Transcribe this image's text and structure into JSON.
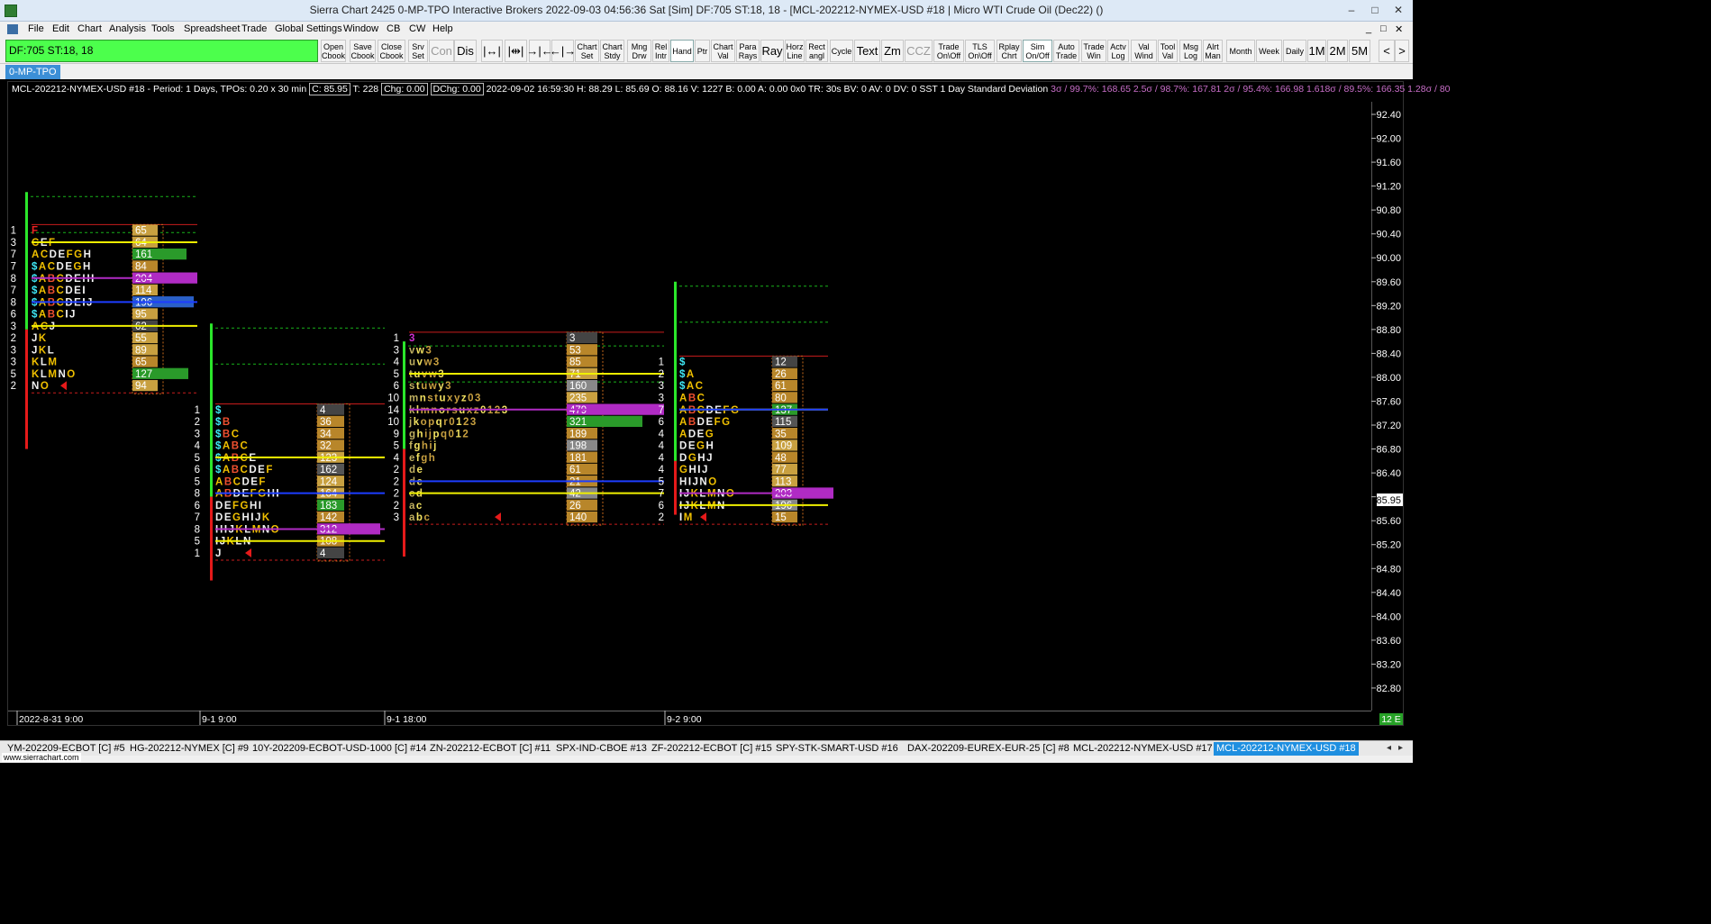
{
  "window": {
    "title": "Sierra Chart 2425 0-MP-TPO  Interactive Brokers 2022-09-03  04:56:36 Sat [Sim]  DF:705  ST:18, 18 - [MCL-202212-NYMEX-USD  #18 | Micro WTI Crude Oil (Dec22) ()",
    "buttons": [
      "–",
      "□",
      "✕"
    ]
  },
  "menu": {
    "items": [
      "File",
      "Edit",
      "Chart",
      "Analysis",
      "Tools",
      "Spreadsheet",
      "Trade",
      "Global Settings",
      "Window",
      "CB",
      "CW",
      "Help"
    ],
    "mdi_buttons": [
      "_",
      "□",
      "✕"
    ]
  },
  "toolbar": {
    "status_text": "DF:705  ST:18, 18",
    "buttons": [
      {
        "label": "Open\nCbook",
        "style": ""
      },
      {
        "label": "Save\nCbook",
        "style": ""
      },
      {
        "label": "Close\nCbook",
        "style": ""
      },
      {
        "label": "Srv\nSet",
        "style": ""
      },
      {
        "label": "Con",
        "style": "big dim"
      },
      {
        "label": "Dis",
        "style": "big"
      },
      {
        "label": "|↔|",
        "style": "big"
      },
      {
        "label": "|⇹|",
        "style": "big"
      },
      {
        "label": "→|←",
        "style": "big"
      },
      {
        "label": "←|→",
        "style": "big"
      },
      {
        "label": "Chart\nSet",
        "style": ""
      },
      {
        "label": "Chart\nStdy",
        "style": ""
      },
      {
        "label": "Mng\nDrw",
        "style": ""
      },
      {
        "label": "Rel\nIntr",
        "style": ""
      },
      {
        "label": "Hand",
        "style": "active"
      },
      {
        "label": "Ptr",
        "style": ""
      },
      {
        "label": "Chart\nVal",
        "style": ""
      },
      {
        "label": "Para\nRays",
        "style": ""
      },
      {
        "label": "Ray",
        "style": "big"
      },
      {
        "label": "Horz\nLine",
        "style": ""
      },
      {
        "label": "Rect\nangl",
        "style": ""
      },
      {
        "label": "Cycle",
        "style": ""
      },
      {
        "label": "Text",
        "style": "big"
      },
      {
        "label": "Zm",
        "style": "big"
      },
      {
        "label": "CCZ",
        "style": "big dim"
      },
      {
        "label": "Trade\nOn\\Off",
        "style": ""
      },
      {
        "label": "TLS\nOn\\Off",
        "style": ""
      },
      {
        "label": "Rplay\nChrt",
        "style": ""
      },
      {
        "label": "Sim\nOn/Off",
        "style": "active"
      },
      {
        "label": "Auto\nTrade",
        "style": ""
      },
      {
        "label": "Trade\nWin",
        "style": ""
      },
      {
        "label": "Actv\nLog",
        "style": ""
      },
      {
        "label": "Val\nWind",
        "style": ""
      },
      {
        "label": "Tool\nVal",
        "style": ""
      },
      {
        "label": "Msg\nLog",
        "style": ""
      },
      {
        "label": "Alrt\nMan",
        "style": ""
      },
      {
        "label": "Month",
        "style": ""
      },
      {
        "label": "Week",
        "style": ""
      },
      {
        "label": "Daily",
        "style": ""
      },
      {
        "label": "1M",
        "style": "big"
      },
      {
        "label": "2M",
        "style": "big"
      },
      {
        "label": "5M",
        "style": "big"
      },
      {
        "label": "<",
        "style": "big"
      },
      {
        "label": ">",
        "style": "big"
      }
    ]
  },
  "chart_tab": "0-MP-TPO",
  "info": {
    "prefix": "MCL-202212-NYMEX-USD  #18 - Period: 1 Days, TPOs: 0.20 x 30 min",
    "close": "C: 85.95",
    "t": "T: 228",
    "chg": "Chg: 0.00",
    "dchg": "DChg: 0.00",
    "rest": "2022-09-02 16:59:30 H: 88.29 L: 85.69 O: 88.16 V: 1227 B: 0.00 A: 0.00 0x0 TR: 30s BV: 0 AV: 0 DV: 0 SST 1 Day Standard Deviation",
    "sd": "3σ / 99.7%: 168.65  2.5σ / 98.7%: 167.81  2σ / 95.4%: 166.98  1.618σ / 89.5%: 166.35  1.28σ / 80"
  },
  "price_axis": {
    "labels": [
      "92.40",
      "92.00",
      "91.60",
      "91.20",
      "90.80",
      "90.40",
      "90.00",
      "89.60",
      "89.20",
      "88.80",
      "88.40",
      "88.00",
      "87.60",
      "87.20",
      "86.80",
      "86.40",
      "86.00",
      "85.60",
      "85.20",
      "84.80",
      "84.40",
      "84.00",
      "83.60",
      "83.20",
      "82.80"
    ],
    "current": "85.95"
  },
  "time_axis": {
    "labels": [
      "2022-8-31  9:00",
      "9-1  9:00",
      "9-1  18:00",
      "9-2  9:00"
    ],
    "badge": "12 E"
  },
  "colors": {
    "green": "#2be72b",
    "red": "#e51a1a",
    "poc": "#b02bc4",
    "vah_val": "#f0f000",
    "blue_line": "#1d3dff",
    "gray_line": "#cfcfcf",
    "dashed_red": "#c81c1c",
    "dashed_green": "#19b21a"
  },
  "chart_data": {
    "type": "table",
    "price_tick": 0.2,
    "profiles": [
      {
        "date": "2022-8-31",
        "high": 91.1,
        "low": 86.8,
        "top_price": 90.4,
        "rows": [
          {
            "c": "1",
            "l": "F",
            "v": "65"
          },
          {
            "c": "3",
            "l": "CEF",
            "v": "64"
          },
          {
            "c": "7",
            "l": "ACDEFGH",
            "v": "161"
          },
          {
            "c": "7",
            "l": "$ACDEGH",
            "v": "84"
          },
          {
            "c": "8",
            "l": "$ABCDEHI",
            "v": "204"
          },
          {
            "c": "7",
            "l": "$ABCDEI",
            "v": "114"
          },
          {
            "c": "8",
            "l": "$ABCDEIJ",
            "v": "196"
          },
          {
            "c": "6",
            "l": "$ABCIJ",
            "v": "95"
          },
          {
            "c": "3",
            "l": "ACJ",
            "v": "62"
          },
          {
            "c": "2",
            "l": "JK",
            "v": "55"
          },
          {
            "c": "3",
            "l": "JKL",
            "v": "89"
          },
          {
            "c": "3",
            "l": "KLM",
            "v": "65"
          },
          {
            "c": "5",
            "l": "KLMNO",
            "v": "127"
          },
          {
            "c": "2",
            "l": "NO",
            "v": "94"
          }
        ]
      },
      {
        "date": "9-1 9:00",
        "high": 88.9,
        "low": 84.6,
        "top_price": 87.4,
        "rows": [
          {
            "c": "1",
            "l": "$",
            "v": "4"
          },
          {
            "c": "2",
            "l": "$B",
            "v": "36"
          },
          {
            "c": "3",
            "l": "$BC",
            "v": "34"
          },
          {
            "c": "4",
            "l": "$ABC",
            "v": "32"
          },
          {
            "c": "5",
            "l": "$ABCE",
            "v": "123"
          },
          {
            "c": "6",
            "l": "$ABCDEF",
            "v": "162"
          },
          {
            "c": "5",
            "l": "ABCDEF",
            "v": "124"
          },
          {
            "c": "8",
            "l": "ABDEFGHI",
            "v": "164"
          },
          {
            "c": "6",
            "l": "DEFGHI",
            "v": "183"
          },
          {
            "c": "7",
            "l": "DEGHIJK",
            "v": "142"
          },
          {
            "c": "8",
            "l": "HIJKLMNO",
            "v": "312"
          },
          {
            "c": "5",
            "l": "IJKLN",
            "v": "108"
          },
          {
            "c": "1",
            "l": "J",
            "v": "4"
          }
        ]
      },
      {
        "date": "9-1 18:00",
        "high": 88.6,
        "low": 85.0,
        "top_price": 88.6,
        "rows": [
          {
            "c": "1",
            "l": "3",
            "v": "3"
          },
          {
            "c": "3",
            "l": "vw3",
            "v": "53"
          },
          {
            "c": "4",
            "l": "uvw3",
            "v": "85"
          },
          {
            "c": "5",
            "l": "tuvw3",
            "v": "71"
          },
          {
            "c": "6",
            "l": "stuwy3",
            "v": "160"
          },
          {
            "c": "10",
            "l": "mnstuxyz03",
            "v": "235"
          },
          {
            "c": "14",
            "l": "klmnorsuxz0123",
            "v": "479"
          },
          {
            "c": "10",
            "l": "jkopqr0123",
            "v": "321"
          },
          {
            "c": "9",
            "l": "ghijpq012",
            "v": "189"
          },
          {
            "c": "5",
            "l": "fghij",
            "v": "198"
          },
          {
            "c": "4",
            "l": "efgh",
            "v": "181"
          },
          {
            "c": "2",
            "l": "de",
            "v": "61"
          },
          {
            "c": "2",
            "l": "de",
            "v": "21"
          },
          {
            "c": "2",
            "l": "cd",
            "v": "42"
          },
          {
            "c": "2",
            "l": "ac",
            "v": "26"
          },
          {
            "c": "3",
            "l": "abc",
            "v": "140"
          }
        ]
      },
      {
        "date": "9-2 9:00",
        "high": 89.6,
        "low": 85.7,
        "top_price": 88.2,
        "rows": [
          {
            "c": "1",
            "l": "$",
            "v": "12"
          },
          {
            "c": "2",
            "l": "$A",
            "v": "26"
          },
          {
            "c": "3",
            "l": "$AC",
            "v": "61"
          },
          {
            "c": "3",
            "l": "ABC",
            "v": "80"
          },
          {
            "c": "7",
            "l": "ABCDEFG",
            "v": "137"
          },
          {
            "c": "6",
            "l": "ABDEFG",
            "v": "115"
          },
          {
            "c": "4",
            "l": "ADEG",
            "v": "35"
          },
          {
            "c": "4",
            "l": "DEGH",
            "v": "109"
          },
          {
            "c": "4",
            "l": "DGHJ",
            "v": "48"
          },
          {
            "c": "4",
            "l": "GHIJ",
            "v": "77"
          },
          {
            "c": "5",
            "l": "HIJNO",
            "v": "113"
          },
          {
            "c": "7",
            "l": "IJKLMNO",
            "v": "203"
          },
          {
            "c": "6",
            "l": "IJKLMN",
            "v": "196"
          },
          {
            "c": "2",
            "l": "IM",
            "v": "15"
          }
        ]
      }
    ]
  },
  "tabs": [
    "YM-202209-ECBOT [C]  #5",
    "HG-202212-NYMEX [C]  #9",
    "10Y-202209-ECBOT-USD-1000 [C]  #14",
    "ZN-202212-ECBOT [C]  #11",
    "SPX-IND-CBOE  #13",
    "ZF-202212-ECBOT [C]  #15",
    "SPY-STK-SMART-USD  #16",
    "DAX-202209-EUREX-EUR-25 [C]  #8",
    "MCL-202212-NYMEX-USD  #17",
    "MCL-202212-NYMEX-USD  #18"
  ],
  "footer": {
    "site": "www.sierrachart.com"
  }
}
